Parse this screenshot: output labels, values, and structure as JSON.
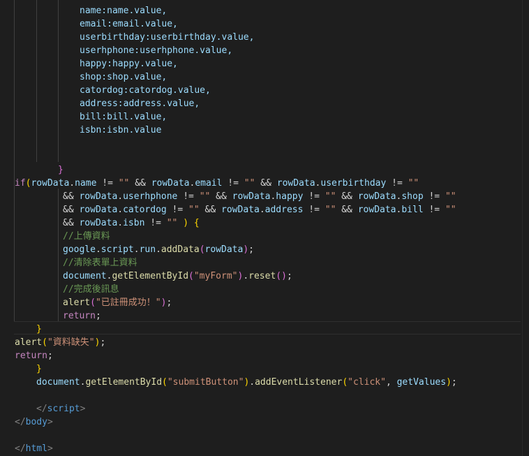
{
  "editor": {
    "lines": [
      {
        "segments": [
          {
            "t": "name:name.value,",
            "c": "var"
          }
        ]
      },
      {
        "segments": [
          {
            "t": "email:email.value,",
            "c": "var"
          }
        ]
      },
      {
        "segments": [
          {
            "t": "userbirthday:userbirthday.value,",
            "c": "var"
          }
        ]
      },
      {
        "segments": [
          {
            "t": "userhphone:userhphone.value,",
            "c": "var"
          }
        ]
      },
      {
        "segments": [
          {
            "t": "happy:happy.value,",
            "c": "var"
          }
        ]
      },
      {
        "segments": [
          {
            "t": "shop:shop.value,",
            "c": "var"
          }
        ]
      },
      {
        "segments": [
          {
            "t": "catordog:catordog.value,",
            "c": "var"
          }
        ]
      },
      {
        "segments": [
          {
            "t": "address:address.value,",
            "c": "var"
          }
        ]
      },
      {
        "segments": [
          {
            "t": "bill:bill.value,",
            "c": "var"
          }
        ]
      },
      {
        "segments": [
          {
            "t": "isbn:isbn.value",
            "c": "var"
          }
        ]
      },
      {
        "segments": []
      },
      {
        "segments": []
      },
      {
        "segments": [
          {
            "t": "}",
            "c": "paren2"
          }
        ]
      },
      {
        "segments": [
          {
            "t": "if",
            "c": "kw"
          },
          {
            "t": "(",
            "c": "brace"
          },
          {
            "t": "rowData",
            "c": "var"
          },
          {
            "t": ".",
            "c": "punc"
          },
          {
            "t": "name",
            "c": "var"
          },
          {
            "t": " != ",
            "c": "punc"
          },
          {
            "t": "\"\"",
            "c": "str"
          },
          {
            "t": " && ",
            "c": "punc"
          },
          {
            "t": "rowData",
            "c": "var"
          },
          {
            "t": ".",
            "c": "punc"
          },
          {
            "t": "email",
            "c": "var"
          },
          {
            "t": " != ",
            "c": "punc"
          },
          {
            "t": "\"\"",
            "c": "str"
          },
          {
            "t": " && ",
            "c": "punc"
          },
          {
            "t": "rowData",
            "c": "var"
          },
          {
            "t": ".",
            "c": "punc"
          },
          {
            "t": "userbirthday",
            "c": "var"
          },
          {
            "t": " != ",
            "c": "punc"
          },
          {
            "t": "\"\"",
            "c": "str"
          }
        ]
      },
      {
        "segments": [
          {
            "t": "&& ",
            "c": "punc"
          },
          {
            "t": "rowData",
            "c": "var"
          },
          {
            "t": ".",
            "c": "punc"
          },
          {
            "t": "userhphone",
            "c": "var"
          },
          {
            "t": " != ",
            "c": "punc"
          },
          {
            "t": "\"\"",
            "c": "str"
          },
          {
            "t": " && ",
            "c": "punc"
          },
          {
            "t": "rowData",
            "c": "var"
          },
          {
            "t": ".",
            "c": "punc"
          },
          {
            "t": "happy",
            "c": "var"
          },
          {
            "t": " != ",
            "c": "punc"
          },
          {
            "t": "\"\"",
            "c": "str"
          },
          {
            "t": " && ",
            "c": "punc"
          },
          {
            "t": "rowData",
            "c": "var"
          },
          {
            "t": ".",
            "c": "punc"
          },
          {
            "t": "shop",
            "c": "var"
          },
          {
            "t": " != ",
            "c": "punc"
          },
          {
            "t": "\"\"",
            "c": "str"
          }
        ]
      },
      {
        "segments": [
          {
            "t": "&& ",
            "c": "punc"
          },
          {
            "t": "rowData",
            "c": "var"
          },
          {
            "t": ".",
            "c": "punc"
          },
          {
            "t": "catordog",
            "c": "var"
          },
          {
            "t": " != ",
            "c": "punc"
          },
          {
            "t": "\"\"",
            "c": "str"
          },
          {
            "t": " && ",
            "c": "punc"
          },
          {
            "t": "rowData",
            "c": "var"
          },
          {
            "t": ".",
            "c": "punc"
          },
          {
            "t": "address",
            "c": "var"
          },
          {
            "t": " != ",
            "c": "punc"
          },
          {
            "t": "\"\"",
            "c": "str"
          },
          {
            "t": " && ",
            "c": "punc"
          },
          {
            "t": "rowData",
            "c": "var"
          },
          {
            "t": ".",
            "c": "punc"
          },
          {
            "t": "bill",
            "c": "var"
          },
          {
            "t": " != ",
            "c": "punc"
          },
          {
            "t": "\"\"",
            "c": "str"
          }
        ]
      },
      {
        "segments": [
          {
            "t": "&& ",
            "c": "punc"
          },
          {
            "t": "rowData",
            "c": "var"
          },
          {
            "t": ".",
            "c": "punc"
          },
          {
            "t": "isbn",
            "c": "var"
          },
          {
            "t": " != ",
            "c": "punc"
          },
          {
            "t": "\"\"",
            "c": "str"
          },
          {
            "t": " ",
            "c": "punc"
          },
          {
            "t": ")",
            "c": "brace"
          },
          {
            "t": " ",
            "c": "punc"
          },
          {
            "t": "{",
            "c": "brace"
          }
        ]
      },
      {
        "segments": [
          {
            "t": "//上傳資料",
            "c": "cmt"
          }
        ]
      },
      {
        "segments": [
          {
            "t": "google",
            "c": "var"
          },
          {
            "t": ".",
            "c": "punc"
          },
          {
            "t": "script",
            "c": "var"
          },
          {
            "t": ".",
            "c": "punc"
          },
          {
            "t": "run",
            "c": "var"
          },
          {
            "t": ".",
            "c": "punc"
          },
          {
            "t": "addData",
            "c": "fn"
          },
          {
            "t": "(",
            "c": "paren2"
          },
          {
            "t": "rowData",
            "c": "var"
          },
          {
            "t": ")",
            "c": "paren2"
          },
          {
            "t": ";",
            "c": "punc"
          }
        ]
      },
      {
        "segments": [
          {
            "t": "//清除表單上資料",
            "c": "cmt"
          }
        ]
      },
      {
        "segments": [
          {
            "t": "document",
            "c": "var"
          },
          {
            "t": ".",
            "c": "punc"
          },
          {
            "t": "getElementById",
            "c": "fn"
          },
          {
            "t": "(",
            "c": "paren2"
          },
          {
            "t": "\"myForm\"",
            "c": "str"
          },
          {
            "t": ")",
            "c": "paren2"
          },
          {
            "t": ".",
            "c": "punc"
          },
          {
            "t": "reset",
            "c": "fn"
          },
          {
            "t": "(",
            "c": "paren2"
          },
          {
            "t": ")",
            "c": "paren2"
          },
          {
            "t": ";",
            "c": "punc"
          }
        ]
      },
      {
        "segments": [
          {
            "t": "//完成後訊息",
            "c": "cmt"
          }
        ]
      },
      {
        "segments": [
          {
            "t": "alert",
            "c": "fn"
          },
          {
            "t": "(",
            "c": "paren2"
          },
          {
            "t": "\"已註冊成功！\"",
            "c": "str"
          },
          {
            "t": ")",
            "c": "paren2"
          },
          {
            "t": ";",
            "c": "punc"
          }
        ]
      },
      {
        "segments": [
          {
            "t": "return",
            "c": "kw"
          },
          {
            "t": ";",
            "c": "punc"
          }
        ]
      },
      {
        "segments": [
          {
            "t": "}",
            "c": "brace"
          }
        ]
      },
      {
        "segments": [
          {
            "t": "alert",
            "c": "fn"
          },
          {
            "t": "(",
            "c": "brace"
          },
          {
            "t": "\"資料缺失\"",
            "c": "str"
          },
          {
            "t": ")",
            "c": "brace"
          },
          {
            "t": ";",
            "c": "punc"
          }
        ]
      },
      {
        "segments": [
          {
            "t": "return",
            "c": "kw"
          },
          {
            "t": ";",
            "c": "punc"
          }
        ]
      },
      {
        "segments": [
          {
            "t": "}",
            "c": "brace"
          }
        ]
      },
      {
        "segments": [
          {
            "t": "document",
            "c": "var"
          },
          {
            "t": ".",
            "c": "punc"
          },
          {
            "t": "getElementById",
            "c": "fn"
          },
          {
            "t": "(",
            "c": "brace"
          },
          {
            "t": "\"submitButton\"",
            "c": "str"
          },
          {
            "t": ")",
            "c": "brace"
          },
          {
            "t": ".",
            "c": "punc"
          },
          {
            "t": "addEventListener",
            "c": "fn"
          },
          {
            "t": "(",
            "c": "brace"
          },
          {
            "t": "\"click\"",
            "c": "str"
          },
          {
            "t": ", ",
            "c": "punc"
          },
          {
            "t": "getValues",
            "c": "var"
          },
          {
            "t": ")",
            "c": "brace"
          },
          {
            "t": ";",
            "c": "punc"
          }
        ]
      },
      {
        "segments": []
      },
      {
        "segments": [
          {
            "t": "</",
            "c": "tag"
          },
          {
            "t": "script",
            "c": "tagname"
          },
          {
            "t": ">",
            "c": "tag"
          }
        ]
      },
      {
        "segments": [
          {
            "t": "</",
            "c": "tag"
          },
          {
            "t": "body",
            "c": "tagname"
          },
          {
            "t": ">",
            "c": "tag"
          }
        ]
      },
      {
        "segments": []
      },
      {
        "segments": [
          {
            "t": "</",
            "c": "tag"
          },
          {
            "t": "html",
            "c": "tagname"
          },
          {
            "t": ">",
            "c": "tag"
          }
        ]
      }
    ]
  },
  "colors": {
    "background": "#1e1e1e",
    "variable": "#9cdcfe",
    "function": "#dcdcaa",
    "string": "#ce9178",
    "comment": "#6a9955",
    "keyword": "#c586c0",
    "bracket_gold": "#ffd700",
    "bracket_orchid": "#da70d6",
    "tag": "#808080",
    "tag_name": "#569cd6"
  }
}
